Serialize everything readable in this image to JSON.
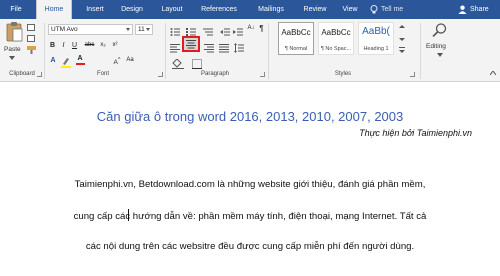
{
  "tabs": [
    {
      "label": "File"
    },
    {
      "label": "Home",
      "active": true
    },
    {
      "label": "Insert"
    },
    {
      "label": "Design"
    },
    {
      "label": "Layout"
    },
    {
      "label": "References"
    },
    {
      "label": "Mailings"
    },
    {
      "label": "Review"
    },
    {
      "label": "View"
    }
  ],
  "tell_me": "Tell me",
  "share": "Share",
  "clipboard": {
    "paste_label": "Paste",
    "group_label": "Clipboard"
  },
  "font": {
    "name": "UTM Avo",
    "size": "11",
    "group_label": "Font"
  },
  "paragraph": {
    "group_label": "Paragraph"
  },
  "styles": {
    "group_label": "Styles",
    "items": [
      {
        "sample": "AaBbCc",
        "name": "¶ Normal"
      },
      {
        "sample": "AaBbCc",
        "name": "¶ No Spac..."
      },
      {
        "sample": "AaBb(",
        "name": "Heading 1"
      }
    ]
  },
  "editing": {
    "label": "Editing"
  },
  "document": {
    "title": "Căn giữa ô trong word 2016, 2013, 2010, 2007, 2003",
    "subtitle": "Thực hiện bởi Taimienphi.vn",
    "lines": [
      "Taimienphi.vn, Betdownload.com là những website giới thiệu, đánh giá phần mềm,",
      "cung cấp các hướng dẫn về: phần mềm máy tính, điện thoại, mạng Internet. Tất cả",
      "các nội dung trên các websitre đều được cung cấp miễn phí đến người dùng."
    ]
  },
  "colors": {
    "tab_bar": "#2b579a",
    "title_blue": "#3a5fb0",
    "highlight_red": "#e01e1e"
  }
}
